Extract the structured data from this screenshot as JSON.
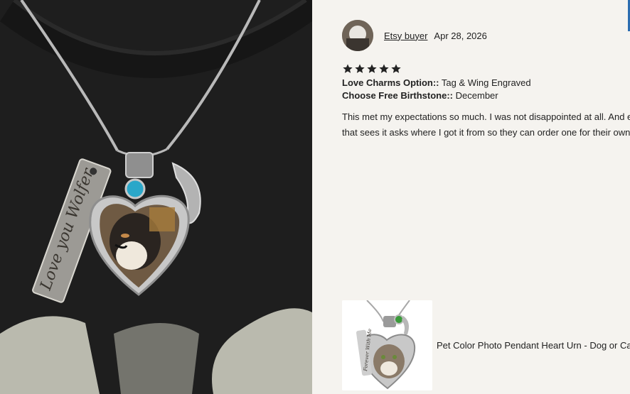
{
  "review": {
    "buyer_name": "Etsy buyer",
    "date": "Apr 28, 2026",
    "rating": 5,
    "options": [
      {
        "label": "Love Charms Option::",
        "value": "Tag & Wing Engraved"
      },
      {
        "label": "Choose Free Birthstone::",
        "value": "December"
      }
    ],
    "text_line1": "This met my expectations so much. I was not disappointed at all. And every",
    "text_line2": "that sees it asks where I got it from so they can order one for their own pet"
  },
  "photo": {
    "tag_engraving": "Love you Wolfer"
  },
  "product": {
    "title": "Pet Color Photo Pendant Heart Urn - Dog or Cat -",
    "thumb_engraving": "Forever With Me"
  },
  "colors": {
    "background": "#f5f3ef",
    "text": "#222222",
    "birthstone": "#2aa7c9",
    "thumb_stone": "#3a9a3a"
  }
}
